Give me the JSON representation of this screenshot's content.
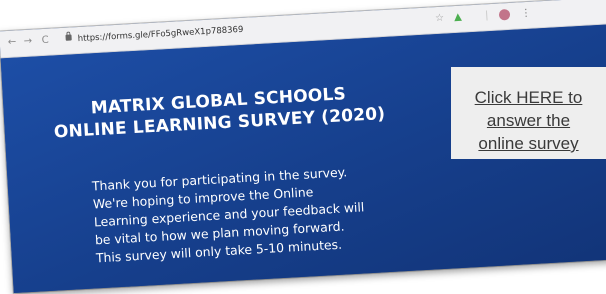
{
  "browser": {
    "url": "https://forms.gle/FFo5gRweX1p788369",
    "nav_back": "←",
    "nav_forward": "→",
    "nav_reload": "C"
  },
  "survey": {
    "title_line1": "MATRIX GLOBAL SCHOOLS",
    "title_line2": "ONLINE LEARNING SURVEY (2020)",
    "message_lines": [
      "Thank you for participating in the survey.",
      "We're hoping to improve the Online",
      "Learning experience and your feedback will",
      "be vital to how we plan moving forward.",
      "This survey will only take 5-10 minutes."
    ]
  },
  "cta": {
    "line1": "Click HERE to",
    "line2": "answer the",
    "line3": "online survey"
  },
  "colors": {
    "page_background": "#1e4a9a",
    "cta_background": "#eeeeee",
    "cta_text": "#3a3a3a"
  }
}
